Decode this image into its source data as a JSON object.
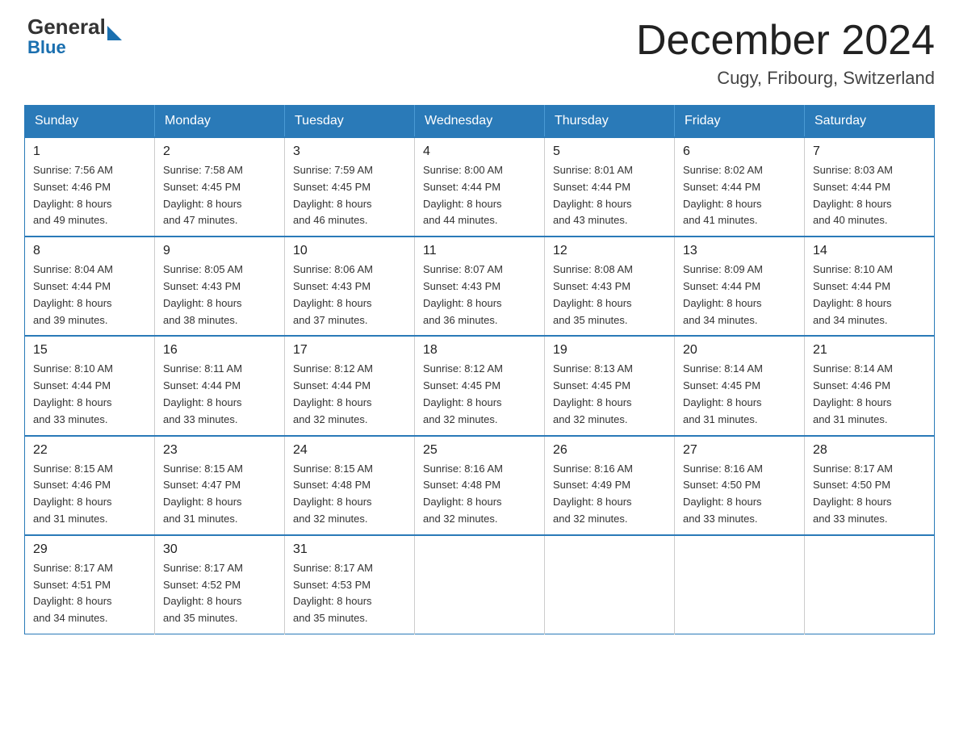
{
  "header": {
    "logo_general": "General",
    "logo_blue": "Blue",
    "title": "December 2024",
    "subtitle": "Cugy, Fribourg, Switzerland"
  },
  "days_of_week": [
    "Sunday",
    "Monday",
    "Tuesday",
    "Wednesday",
    "Thursday",
    "Friday",
    "Saturday"
  ],
  "weeks": [
    [
      {
        "date": "1",
        "sunrise": "7:56 AM",
        "sunset": "4:46 PM",
        "daylight": "8 hours and 49 minutes."
      },
      {
        "date": "2",
        "sunrise": "7:58 AM",
        "sunset": "4:45 PM",
        "daylight": "8 hours and 47 minutes."
      },
      {
        "date": "3",
        "sunrise": "7:59 AM",
        "sunset": "4:45 PM",
        "daylight": "8 hours and 46 minutes."
      },
      {
        "date": "4",
        "sunrise": "8:00 AM",
        "sunset": "4:44 PM",
        "daylight": "8 hours and 44 minutes."
      },
      {
        "date": "5",
        "sunrise": "8:01 AM",
        "sunset": "4:44 PM",
        "daylight": "8 hours and 43 minutes."
      },
      {
        "date": "6",
        "sunrise": "8:02 AM",
        "sunset": "4:44 PM",
        "daylight": "8 hours and 41 minutes."
      },
      {
        "date": "7",
        "sunrise": "8:03 AM",
        "sunset": "4:44 PM",
        "daylight": "8 hours and 40 minutes."
      }
    ],
    [
      {
        "date": "8",
        "sunrise": "8:04 AM",
        "sunset": "4:44 PM",
        "daylight": "8 hours and 39 minutes."
      },
      {
        "date": "9",
        "sunrise": "8:05 AM",
        "sunset": "4:43 PM",
        "daylight": "8 hours and 38 minutes."
      },
      {
        "date": "10",
        "sunrise": "8:06 AM",
        "sunset": "4:43 PM",
        "daylight": "8 hours and 37 minutes."
      },
      {
        "date": "11",
        "sunrise": "8:07 AM",
        "sunset": "4:43 PM",
        "daylight": "8 hours and 36 minutes."
      },
      {
        "date": "12",
        "sunrise": "8:08 AM",
        "sunset": "4:43 PM",
        "daylight": "8 hours and 35 minutes."
      },
      {
        "date": "13",
        "sunrise": "8:09 AM",
        "sunset": "4:44 PM",
        "daylight": "8 hours and 34 minutes."
      },
      {
        "date": "14",
        "sunrise": "8:10 AM",
        "sunset": "4:44 PM",
        "daylight": "8 hours and 34 minutes."
      }
    ],
    [
      {
        "date": "15",
        "sunrise": "8:10 AM",
        "sunset": "4:44 PM",
        "daylight": "8 hours and 33 minutes."
      },
      {
        "date": "16",
        "sunrise": "8:11 AM",
        "sunset": "4:44 PM",
        "daylight": "8 hours and 33 minutes."
      },
      {
        "date": "17",
        "sunrise": "8:12 AM",
        "sunset": "4:44 PM",
        "daylight": "8 hours and 32 minutes."
      },
      {
        "date": "18",
        "sunrise": "8:12 AM",
        "sunset": "4:45 PM",
        "daylight": "8 hours and 32 minutes."
      },
      {
        "date": "19",
        "sunrise": "8:13 AM",
        "sunset": "4:45 PM",
        "daylight": "8 hours and 32 minutes."
      },
      {
        "date": "20",
        "sunrise": "8:14 AM",
        "sunset": "4:45 PM",
        "daylight": "8 hours and 31 minutes."
      },
      {
        "date": "21",
        "sunrise": "8:14 AM",
        "sunset": "4:46 PM",
        "daylight": "8 hours and 31 minutes."
      }
    ],
    [
      {
        "date": "22",
        "sunrise": "8:15 AM",
        "sunset": "4:46 PM",
        "daylight": "8 hours and 31 minutes."
      },
      {
        "date": "23",
        "sunrise": "8:15 AM",
        "sunset": "4:47 PM",
        "daylight": "8 hours and 31 minutes."
      },
      {
        "date": "24",
        "sunrise": "8:15 AM",
        "sunset": "4:48 PM",
        "daylight": "8 hours and 32 minutes."
      },
      {
        "date": "25",
        "sunrise": "8:16 AM",
        "sunset": "4:48 PM",
        "daylight": "8 hours and 32 minutes."
      },
      {
        "date": "26",
        "sunrise": "8:16 AM",
        "sunset": "4:49 PM",
        "daylight": "8 hours and 32 minutes."
      },
      {
        "date": "27",
        "sunrise": "8:16 AM",
        "sunset": "4:50 PM",
        "daylight": "8 hours and 33 minutes."
      },
      {
        "date": "28",
        "sunrise": "8:17 AM",
        "sunset": "4:50 PM",
        "daylight": "8 hours and 33 minutes."
      }
    ],
    [
      {
        "date": "29",
        "sunrise": "8:17 AM",
        "sunset": "4:51 PM",
        "daylight": "8 hours and 34 minutes."
      },
      {
        "date": "30",
        "sunrise": "8:17 AM",
        "sunset": "4:52 PM",
        "daylight": "8 hours and 35 minutes."
      },
      {
        "date": "31",
        "sunrise": "8:17 AM",
        "sunset": "4:53 PM",
        "daylight": "8 hours and 35 minutes."
      },
      null,
      null,
      null,
      null
    ]
  ],
  "labels": {
    "sunrise": "Sunrise: ",
    "sunset": "Sunset: ",
    "daylight": "Daylight: "
  }
}
